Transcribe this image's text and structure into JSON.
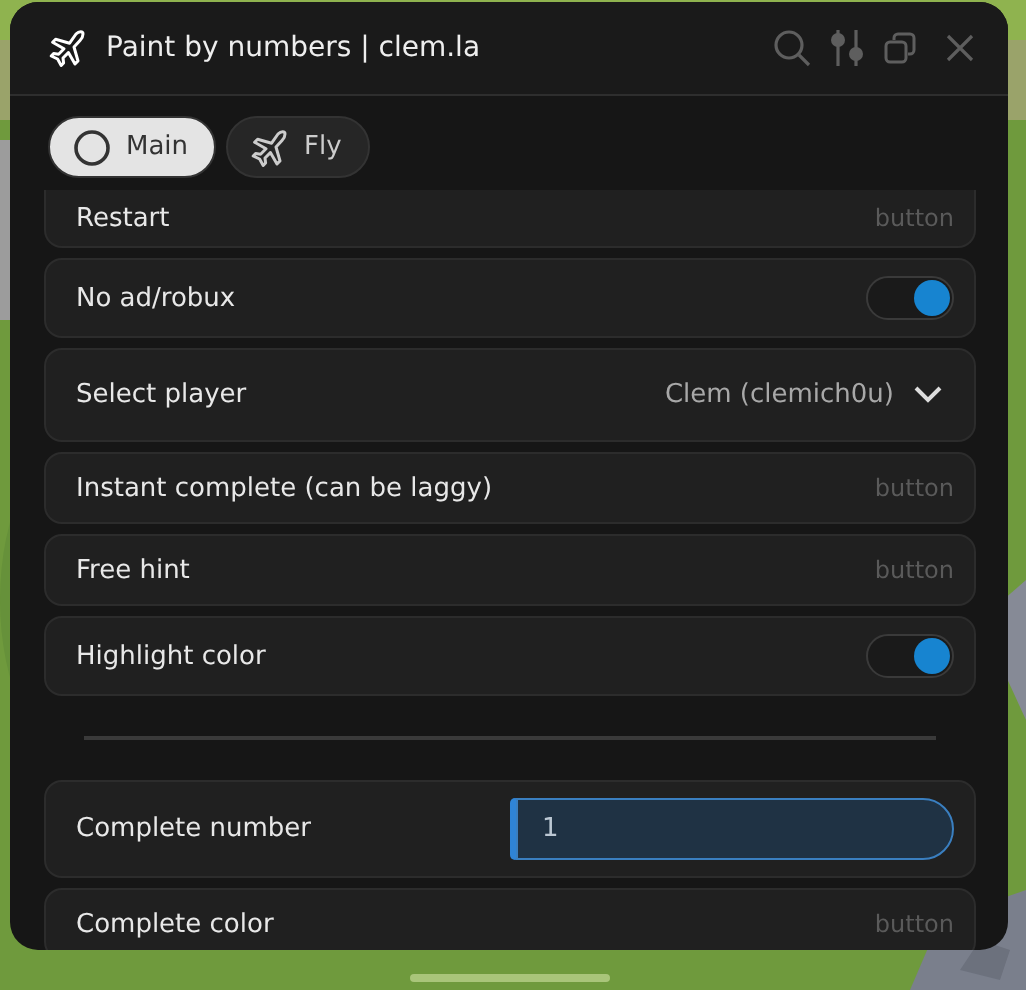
{
  "window": {
    "title": "Paint by numbers | clem.la"
  },
  "tabs": [
    {
      "label": "Main",
      "selected": true
    },
    {
      "label": "Fly",
      "selected": false
    }
  ],
  "items": [
    {
      "kind": "button",
      "label": "Restart",
      "hint": "button"
    },
    {
      "kind": "toggle",
      "label": "No ad/robux",
      "on": true
    },
    {
      "kind": "dropdown",
      "label": "Select player",
      "value": "Clem (clemich0u)"
    },
    {
      "kind": "button",
      "label": "Instant complete (can be laggy)",
      "hint": "button"
    },
    {
      "kind": "button",
      "label": "Free hint",
      "hint": "button"
    },
    {
      "kind": "toggle",
      "label": "Highlight color",
      "on": true
    },
    {
      "kind": "divider"
    },
    {
      "kind": "input",
      "label": "Complete number",
      "value": "1"
    },
    {
      "kind": "button",
      "label": "Complete color",
      "hint": "button"
    }
  ]
}
